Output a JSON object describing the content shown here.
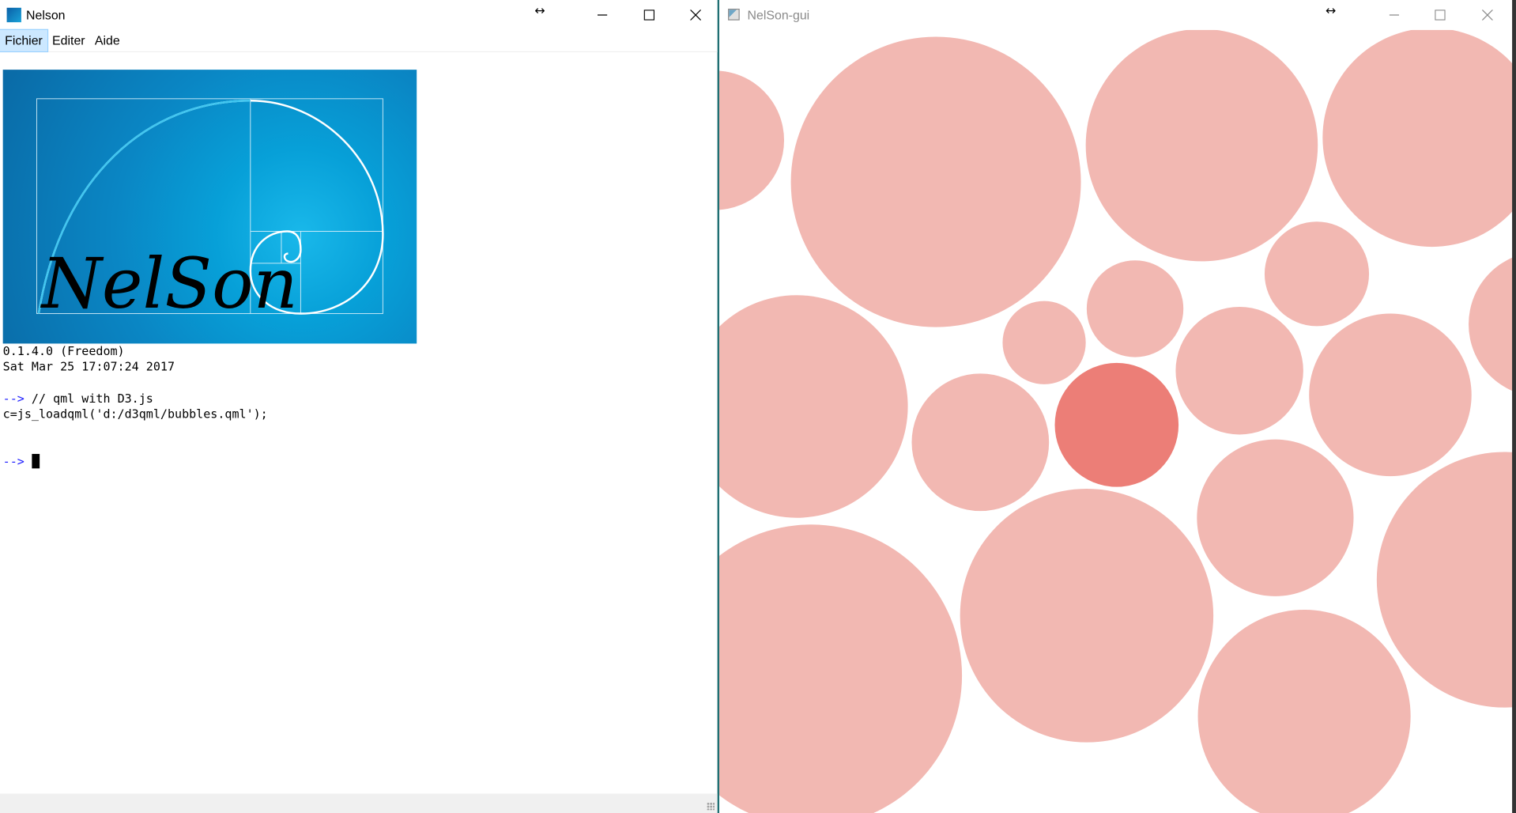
{
  "left_window": {
    "title": "Nelson",
    "menu": [
      "Fichier",
      "Editer",
      "Aide"
    ],
    "logo": {
      "text": "NelSon"
    },
    "console": {
      "version_line": "0.1.4.0 (Freedom)",
      "date_line": "Sat Mar 25 17:07:24 2017",
      "prompt": "-->",
      "comment_line": " // qml with D3.js",
      "command_line": "c=js_loadqml('d:/d3qml/bubbles.qml');"
    },
    "controls": [
      "minimize-icon",
      "maximize-icon",
      "close-icon"
    ]
  },
  "right_window": {
    "title": "NelSon-gui",
    "controls": [
      "minimize-icon",
      "maximize-icon",
      "close-icon"
    ]
  },
  "colors": {
    "bubble": "#f2b8b2",
    "bubble_highlight": "#ec7e77",
    "prompt": "#2020ff",
    "logo_blue": "#0a86c4"
  }
}
